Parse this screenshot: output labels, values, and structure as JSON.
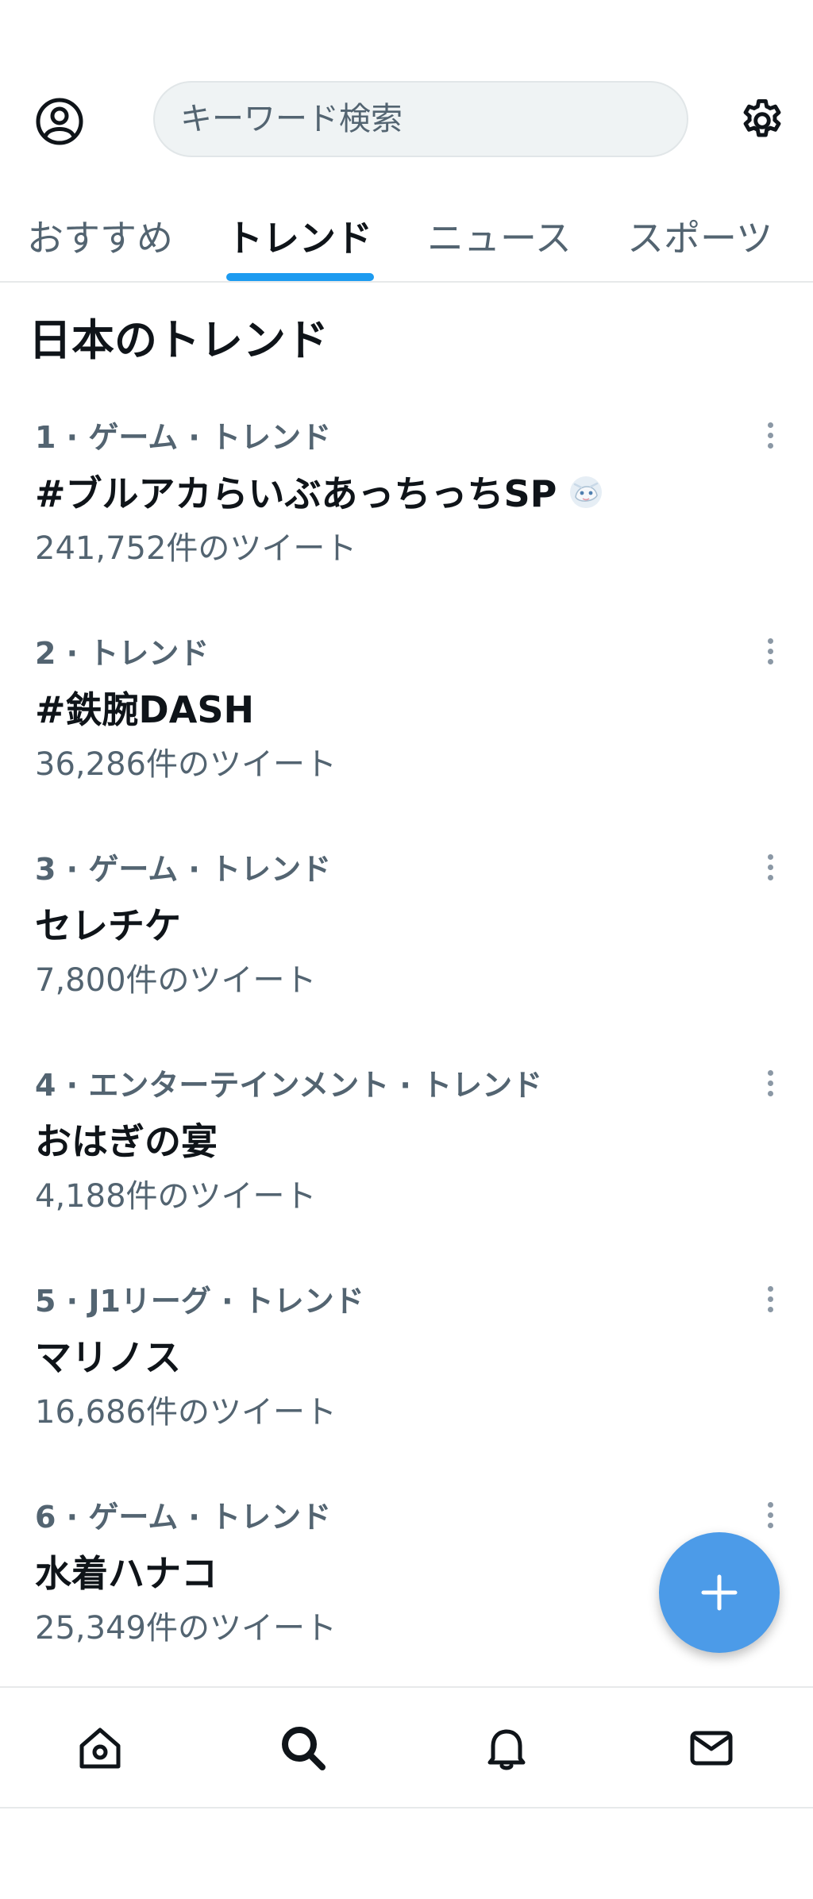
{
  "search": {
    "placeholder": "キーワード検索"
  },
  "tabs": [
    {
      "label": "おすすめ"
    },
    {
      "label": "トレンド"
    },
    {
      "label": "ニュース"
    },
    {
      "label": "スポーツ"
    }
  ],
  "section": {
    "title": "日本のトレンド"
  },
  "trends": [
    {
      "meta": "1 · ゲーム · トレンド",
      "name": "#ブルアカらいぶあっちっちSP",
      "count": "241,752件のツイート"
    },
    {
      "meta": "2 · トレンド",
      "name": "#鉄腕DASH",
      "count": "36,286件のツイート"
    },
    {
      "meta": "3 · ゲーム · トレンド",
      "name": "セレチケ",
      "count": "7,800件のツイート"
    },
    {
      "meta": "4 · エンターテインメント · トレンド",
      "name": "おはぎの宴",
      "count": "4,188件のツイート"
    },
    {
      "meta": "5 · J1リーグ · トレンド",
      "name": "マリノス",
      "count": "16,686件のツイート"
    },
    {
      "meta": "6 · ゲーム · トレンド",
      "name": "水着ハナコ",
      "count": "25,349件のツイート"
    }
  ],
  "icons": {
    "profile": "profile-icon",
    "settings": "gear-icon",
    "compose": "plus-icon",
    "home": "home-icon",
    "search": "search-icon",
    "notifications": "bell-icon",
    "messages": "mail-icon"
  },
  "colors": {
    "accent": "#1d9bf0",
    "fab": "#4c9be8",
    "muted": "#536471"
  }
}
